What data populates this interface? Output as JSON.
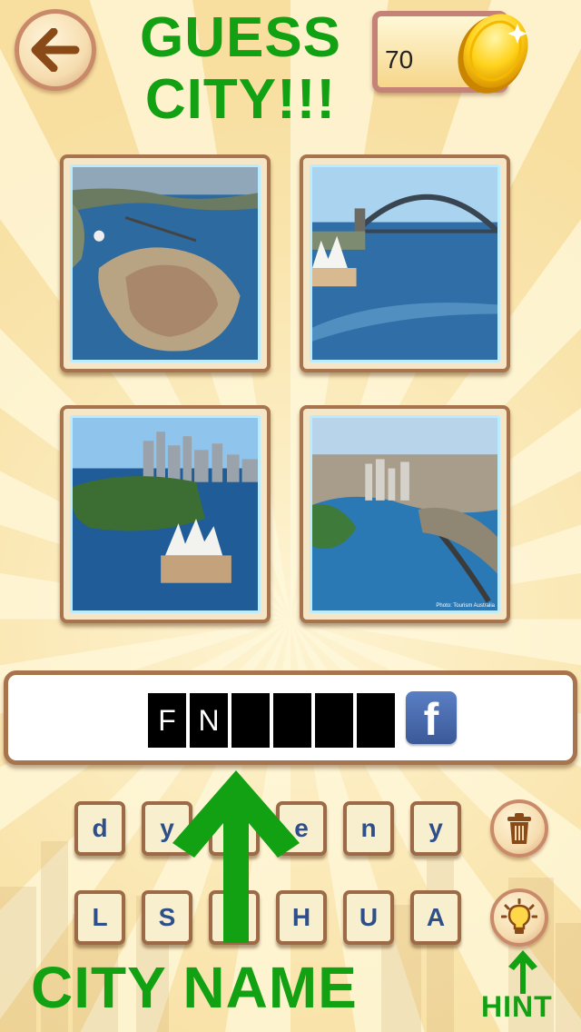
{
  "header": {
    "title_line1": "GUESS",
    "title_line2": "CITY!!!",
    "coins": "70"
  },
  "photos": [
    {
      "name": "aerial-harbour-peninsula"
    },
    {
      "name": "harbour-bridge-opera-house"
    },
    {
      "name": "opera-house-skyline"
    },
    {
      "name": "aerial-city-bridge",
      "credit": "Photo: Tourism Australia"
    }
  ],
  "answer": {
    "slots": [
      "F",
      "N",
      "",
      "",
      "",
      ""
    ],
    "share_label": "f"
  },
  "letters": {
    "row1": [
      "d",
      "y",
      "",
      "e",
      "n",
      "y"
    ],
    "row2": [
      "L",
      "S",
      "",
      "H",
      "U",
      "A"
    ]
  },
  "annotations": {
    "city_name": "CITY NAME",
    "hint": "HINT"
  },
  "colors": {
    "title_green": "#12a112",
    "tile_text": "#2e4f8a",
    "frame_brown": "#a8744e"
  }
}
